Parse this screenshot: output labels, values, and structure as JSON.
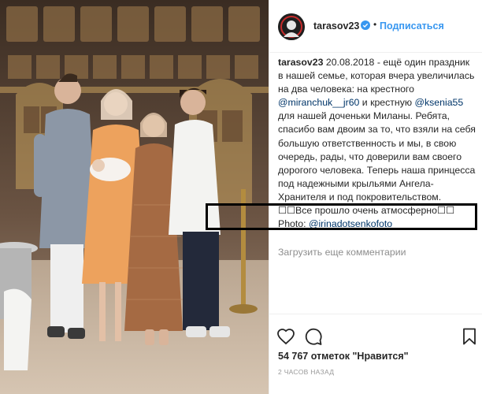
{
  "post": {
    "username": "tarasov23",
    "follow_label": "Подписаться",
    "separator": "•"
  },
  "caption": {
    "username": "tarasov23",
    "t1": " 20.08.2018 - ещё один праздник в нашей семье, которая вчера увеличилась на два человека: на крестного ",
    "m1": "@miranchuk__jr60",
    "t2": " и крестную ",
    "m2": "@ksenia55",
    "t3": " для нашей доченьки Миланы. Ребята, спасибо вам двоим за то, что взяли на себя большую ответственность и мы, в свою очередь, рады, что доверили вам своего дорогого человека. Теперь наша принцесса под надежными крыльями Ангела-Хранителя и под покровительством. ☐☐Все прошло очень атмосферно☐☐",
    "photo_label": "Photo: ",
    "m3": "@irinadotsenkofoto"
  },
  "comments": {
    "load_more": "Загрузить еще комментарии"
  },
  "actions": {
    "icons": [
      "heart-icon",
      "comment-icon",
      "bookmark-icon"
    ]
  },
  "likes": {
    "text": "54 767 отметок \"Нравится\""
  },
  "timestamp": "2 ЧАСОВ НАЗАД",
  "colors": {
    "link": "#003569",
    "follow": "#3897f0",
    "verified": "#3897f0",
    "muted": "#8e8e8e"
  }
}
